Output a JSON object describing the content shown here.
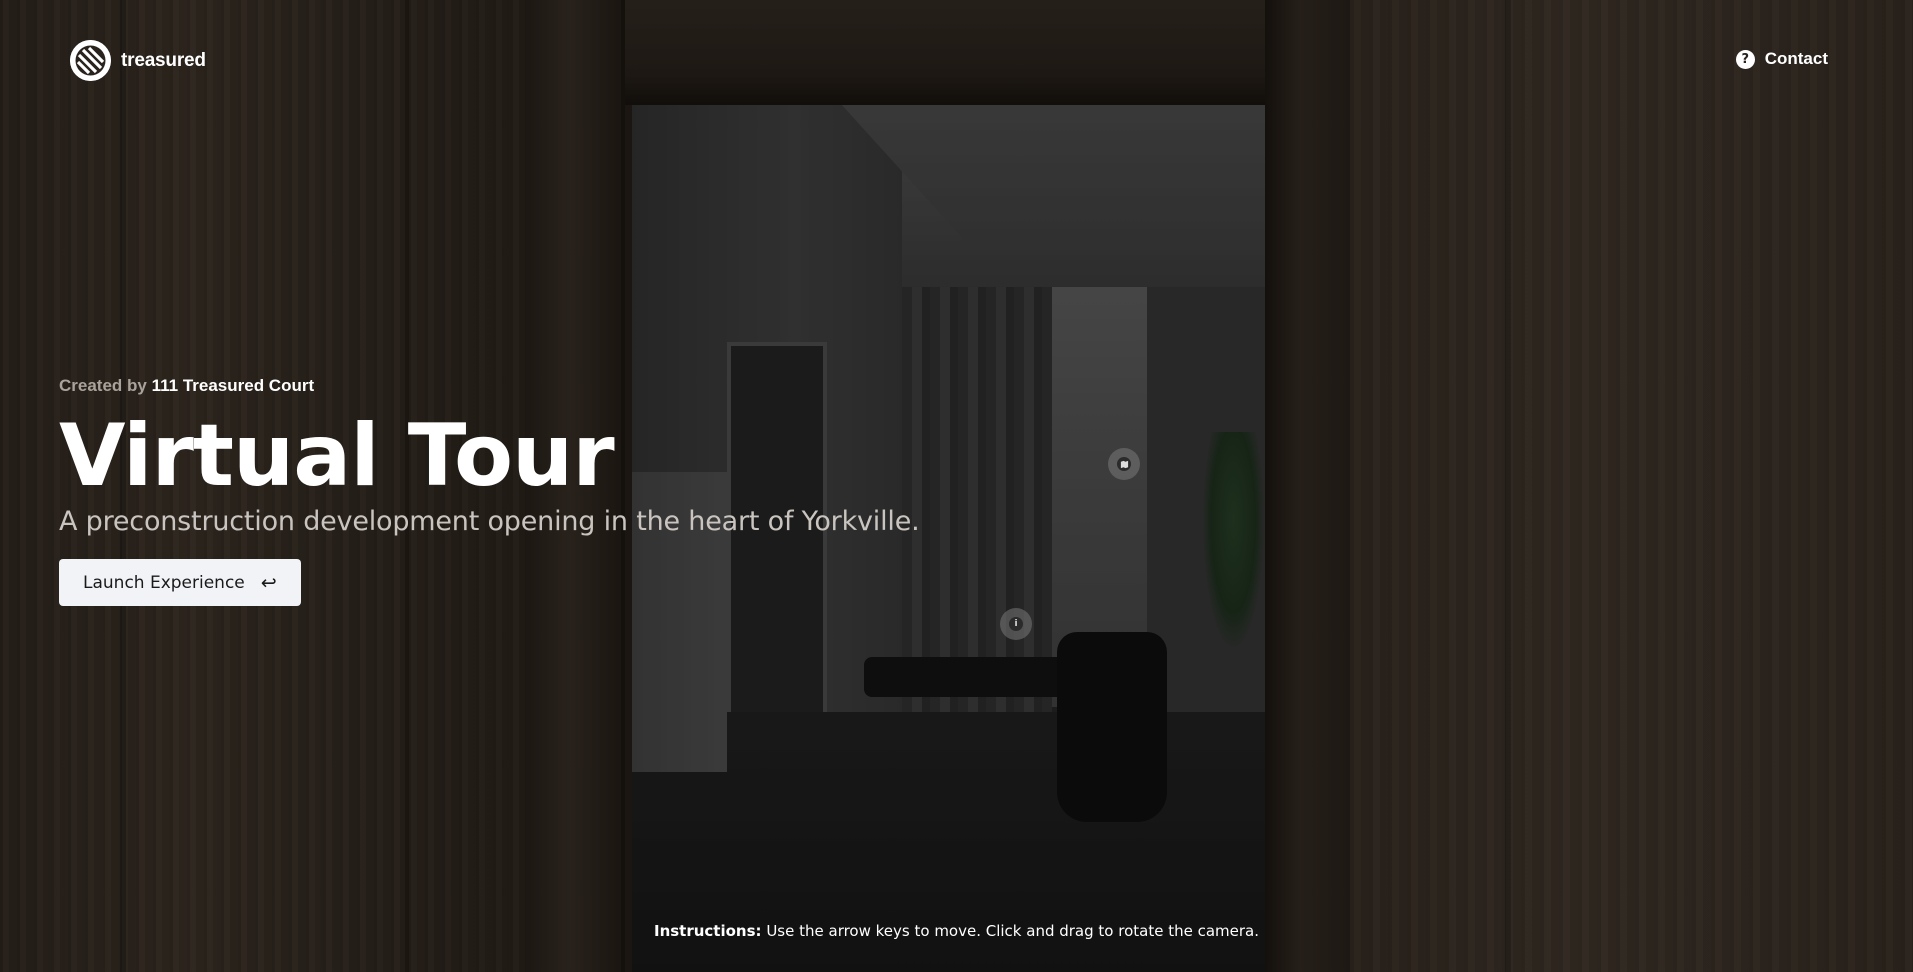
{
  "brand": {
    "name": "treasured",
    "logo_icon": "treasured-logo-icon"
  },
  "header": {
    "contact_label": "Contact",
    "contact_icon": "question-circle-icon"
  },
  "hero": {
    "created_by_prefix": "Created by",
    "created_by_name": "111 Treasured Court",
    "title": "Virtual Tour",
    "subtitle": "A preconstruction development opening in the heart of Yorkville.",
    "launch_label": "Launch Experience",
    "launch_icon": "enter-arrow-icon"
  },
  "hotspots": {
    "map_icon": "map-icon",
    "info_icon": "info-icon"
  },
  "instructions": {
    "label": "Instructions:",
    "text": "Use the arrow keys to move. Click and drag to rotate the camera."
  },
  "colors": {
    "button_bg": "#f1f3f6",
    "muted_text": "#a9a29b",
    "text": "#ffffff"
  }
}
